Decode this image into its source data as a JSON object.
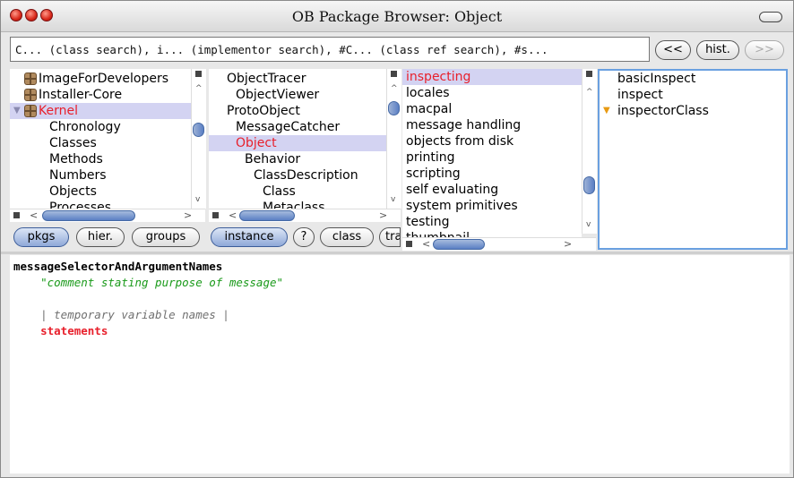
{
  "window": {
    "title": "OB Package Browser: Object"
  },
  "search": {
    "text": "C... (class search), i... (implementor search), #C... (class ref search), #s...\n(sender search)"
  },
  "nav": {
    "back": "<<",
    "history": "hist.",
    "forward": ">>"
  },
  "packages": {
    "items": [
      {
        "label": "ImageForDevelopers",
        "icon": "package-icon"
      },
      {
        "label": "Installer-Core",
        "icon": "package-icon"
      },
      {
        "label": "Kernel",
        "icon": "package-icon",
        "expanded": true,
        "selected": true
      },
      {
        "label": "Chronology"
      },
      {
        "label": "Classes"
      },
      {
        "label": "Methods"
      },
      {
        "label": "Numbers"
      },
      {
        "label": "Objects"
      },
      {
        "label": "Processes"
      }
    ]
  },
  "classes": {
    "items": [
      {
        "label": "ObjectTracer"
      },
      {
        "label": "ObjectViewer"
      },
      {
        "label": "ProtoObject"
      },
      {
        "label": "MessageCatcher"
      },
      {
        "label": "Object",
        "selected": true
      },
      {
        "label": "Behavior"
      },
      {
        "label": "ClassDescription"
      },
      {
        "label": "Class"
      },
      {
        "label": "Metaclass"
      }
    ]
  },
  "protocols": {
    "items": [
      {
        "label": "inspecting",
        "selected": true
      },
      {
        "label": "locales"
      },
      {
        "label": "macpal"
      },
      {
        "label": "message handling"
      },
      {
        "label": "objects from disk"
      },
      {
        "label": "printing"
      },
      {
        "label": "scripting"
      },
      {
        "label": "self evaluating"
      },
      {
        "label": "system primitives"
      },
      {
        "label": "testing"
      },
      {
        "label": "thumbnail"
      }
    ]
  },
  "methods": {
    "items": [
      {
        "label": "basicInspect"
      },
      {
        "label": "inspect"
      },
      {
        "label": "inspectorClass",
        "marker": "override-triangle-icon"
      }
    ]
  },
  "buttons": {
    "pkgs": "pkgs",
    "hier": "hier.",
    "groups": "groups",
    "instance": "instance",
    "help": "?",
    "class": "class",
    "traits": "traits"
  },
  "editor": {
    "lines": [
      "messageSelectorAndArgumentNames",
      "    \"comment stating purpose of message\"",
      "",
      "    | temporary variable names |",
      "    statements"
    ]
  },
  "colors": {
    "selection": "#d3d3f2",
    "highlight_text": "#e8202c",
    "comment": "#1a9a1a",
    "temps": "#707070",
    "scroll_thumb": "#5a7fc4"
  }
}
